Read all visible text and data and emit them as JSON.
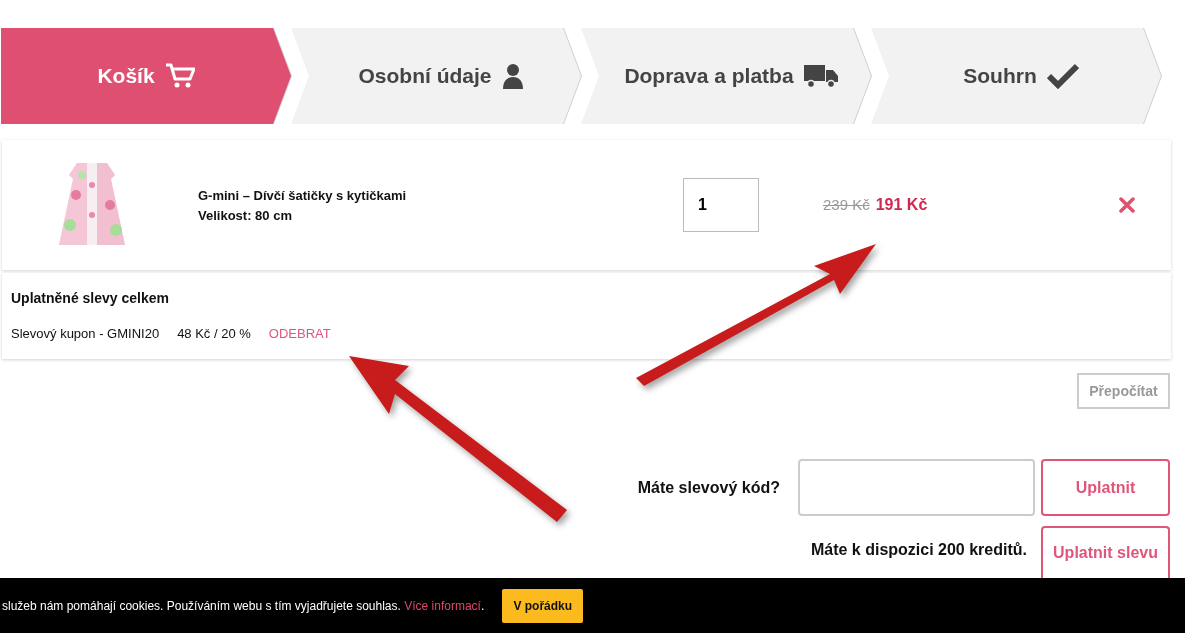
{
  "steps": [
    {
      "label": "Košík",
      "kind": "cart",
      "selected": true
    },
    {
      "label": "Osobní údaje",
      "kind": "user",
      "selected": false
    },
    {
      "label": "Doprava a platba",
      "kind": "truck",
      "selected": false
    },
    {
      "label": "Souhrn",
      "kind": "check",
      "selected": false
    }
  ],
  "cart_item": {
    "name": "G-mini – Dívčí šatičky s kytičkami",
    "size": "Velikost: 80 cm",
    "quantity": "1",
    "old_price": "239 Kč",
    "price": "191 Kč"
  },
  "discounts": {
    "title": "Uplatněné slevy celkem",
    "coupon": "Slevový kupon - GMINI20",
    "amount": "48 Kč / 20 %",
    "remove_link": "ODEBRAT"
  },
  "recalculate_button": "Přepočítat",
  "coupon": {
    "label": "Máte slevový kód?",
    "button": "Uplatnit"
  },
  "credits": {
    "label": "Máte k dispozici 200 kreditů.",
    "button": "Uplatnit slevu"
  },
  "cookie_bar": {
    "text": "služeb nám pomáhají cookies. Používáním webu s tím vyjadřujete souhlas.",
    "link": "Více informací",
    "suffix": ".",
    "button": "V pořádku"
  }
}
